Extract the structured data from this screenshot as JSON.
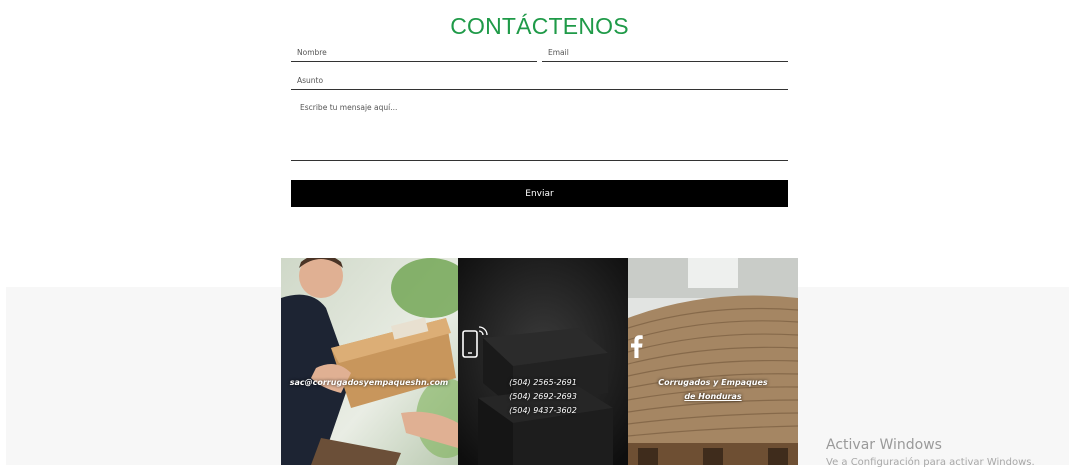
{
  "form": {
    "title": "CONTÁCTENOS",
    "name_placeholder": "Nombre",
    "email_placeholder": "Email",
    "subject_placeholder": "Asunto",
    "message_placeholder": "Escribe tu mensaje aquí...",
    "send_label": "Enviar",
    "title_color": "#1f9a48"
  },
  "panels": {
    "email": {
      "text": "sac@corrugadosyempaqueshn.com"
    },
    "phone": {
      "icon": "smartphone-signal-icon",
      "numbers": [
        "(504) 2565-2691",
        "(504) 2692-2693",
        "(504) 9437-3602"
      ]
    },
    "facebook": {
      "icon": "facebook-icon",
      "line1": "Corrugados y Empaques",
      "line2": "de Honduras"
    }
  },
  "system": {
    "watermark_title": "Activar Windows",
    "watermark_sub": "Ve a Configuración para activar Windows."
  }
}
